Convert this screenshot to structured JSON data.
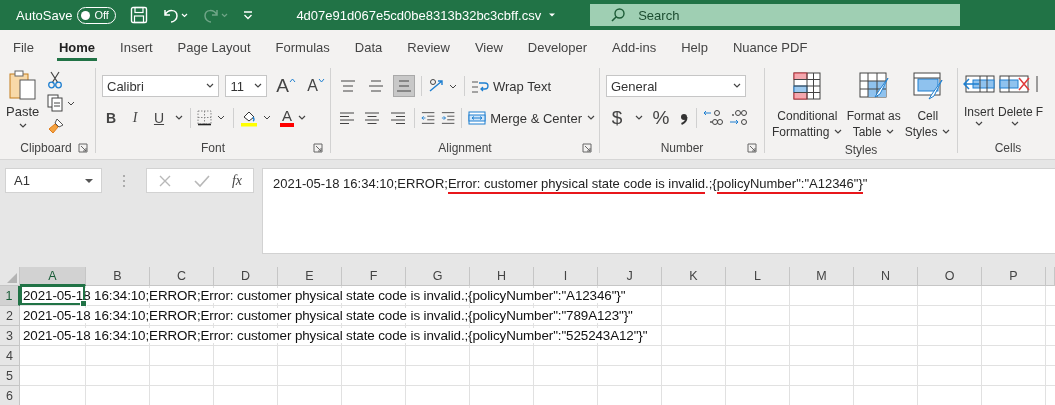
{
  "title_bar": {
    "autosave_label": "AutoSave",
    "autosave_on": false,
    "autosave_state": "Off",
    "filename": "4d07e91d067e5cd0be8313b32bc3cbff.csv",
    "search_placeholder": "Search"
  },
  "tabs": [
    {
      "label": "File",
      "selected": false
    },
    {
      "label": "Home",
      "selected": true
    },
    {
      "label": "Insert",
      "selected": false
    },
    {
      "label": "Page Layout",
      "selected": false
    },
    {
      "label": "Formulas",
      "selected": false
    },
    {
      "label": "Data",
      "selected": false
    },
    {
      "label": "Review",
      "selected": false
    },
    {
      "label": "View",
      "selected": false
    },
    {
      "label": "Developer",
      "selected": false
    },
    {
      "label": "Add-ins",
      "selected": false
    },
    {
      "label": "Help",
      "selected": false
    },
    {
      "label": "Nuance PDF",
      "selected": false
    }
  ],
  "ribbon": {
    "clipboard": {
      "title": "Clipboard",
      "paste": "Paste"
    },
    "font": {
      "title": "Font",
      "font_name": "Calibri",
      "font_size": "11",
      "grow": "A",
      "shrink": "A",
      "styles": [
        {
          "kind": "bold",
          "glyph": "B"
        },
        {
          "kind": "italic",
          "glyph": "I"
        },
        {
          "kind": "underline",
          "glyph": "U"
        }
      ],
      "font_color_glyph": "A"
    },
    "alignment": {
      "title": "Alignment",
      "vertical": [
        {
          "kind": "top",
          "selected": false
        },
        {
          "kind": "middle",
          "selected": false
        },
        {
          "kind": "bottom",
          "selected": true
        }
      ],
      "horizontal": [
        {
          "kind": "left",
          "selected": false
        },
        {
          "kind": "center",
          "selected": false
        },
        {
          "kind": "right",
          "selected": false
        }
      ],
      "wrap_text": "Wrap Text",
      "merge": "Merge & Center"
    },
    "number": {
      "title": "Number",
      "format": "General",
      "currency": "$",
      "percent": "%"
    },
    "styles": {
      "title": "Styles",
      "buttons": [
        {
          "kind": "conditional",
          "lines": [
            "Conditional",
            "Formatting"
          ]
        },
        {
          "kind": "table",
          "lines": [
            "Format as",
            "Table"
          ]
        },
        {
          "kind": "cell",
          "lines": [
            "Cell",
            "Styles"
          ]
        }
      ]
    },
    "cells": {
      "title": "Cells",
      "buttons": [
        {
          "kind": "insert",
          "label": "Insert"
        },
        {
          "kind": "delete",
          "label": "Delete"
        },
        {
          "kind": "format",
          "label": "F"
        }
      ]
    }
  },
  "formula_bar": {
    "name_box": "A1",
    "fx": "fx",
    "segments": [
      {
        "text": "2021-05-18 16:34:10;ERROR;",
        "underlined": false
      },
      {
        "text": "Error: customer physical state code is invalid",
        "underlined": true
      },
      {
        "text": ".;{",
        "underlined": false
      },
      {
        "text": "policyNumber\":\"A12346\"}",
        "underlined": true
      },
      {
        "text": "\"",
        "underlined": false
      }
    ]
  },
  "sheet": {
    "columns": [
      {
        "label": "A",
        "selected": true
      },
      {
        "label": "B",
        "selected": false
      },
      {
        "label": "C",
        "selected": false
      },
      {
        "label": "D",
        "selected": false
      },
      {
        "label": "E",
        "selected": false
      },
      {
        "label": "F",
        "selected": false
      },
      {
        "label": "G",
        "selected": false
      },
      {
        "label": "H",
        "selected": false
      },
      {
        "label": "I",
        "selected": false
      },
      {
        "label": "J",
        "selected": false
      },
      {
        "label": "K",
        "selected": false
      },
      {
        "label": "L",
        "selected": false
      },
      {
        "label": "M",
        "selected": false
      },
      {
        "label": "N",
        "selected": false
      },
      {
        "label": "O",
        "selected": false
      },
      {
        "label": "P",
        "selected": false
      }
    ],
    "rows": [
      {
        "number": "1",
        "selected": true,
        "text": "2021-05-18 16:34:10;ERROR;Error: customer physical state code is invalid.;{policyNumber\":\"A12346\"}\""
      },
      {
        "number": "2",
        "selected": false,
        "text": "2021-05-18 16:34:10;ERROR;Error: customer physical state code is invalid.;{policyNumber\":\"789A123\"}\""
      },
      {
        "number": "3",
        "selected": false,
        "text": "2021-05-18 16:34:10;ERROR;Error: customer physical state code is invalid.;{policyNumber\":\"525243A12\"}\""
      },
      {
        "number": "4",
        "selected": false
      },
      {
        "number": "5",
        "selected": false
      },
      {
        "number": "6",
        "selected": false
      }
    ]
  }
}
